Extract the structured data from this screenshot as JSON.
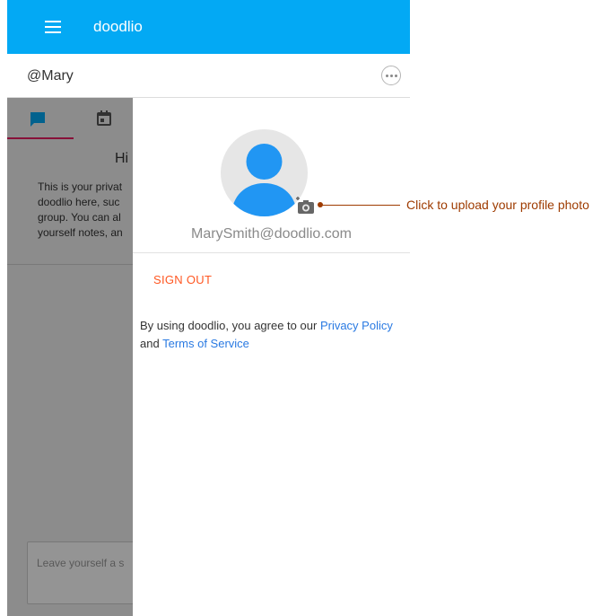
{
  "header": {
    "app_title": "doodlio",
    "menu_icon": "hamburger-menu-icon",
    "bg_color": "#03a9f4"
  },
  "user_bar": {
    "username": "@Mary",
    "more_icon": "more-options-icon"
  },
  "chat_pane": {
    "tabs": [
      {
        "icon": "chat-bubble-icon",
        "active": true
      },
      {
        "icon": "calendar-icon",
        "active": false
      }
    ],
    "greeting": "Hi",
    "intro_lines": [
      "This is your privat",
      "doodlio here, suc",
      "group. You can al",
      "yourself notes, an"
    ],
    "note_placeholder": "Leave yourself a s"
  },
  "profile_panel": {
    "email": "MarySmith@doodlio.com",
    "camera_icon": "add-photo-camera-icon",
    "sign_out_label": "SIGN OUT",
    "agreement": {
      "prefix": "By using doodlio, you agree to our",
      "privacy_link": "Privacy Policy",
      "and": "and",
      "terms_link": "Terms of Service"
    }
  },
  "callout": {
    "text": "Click to upload your profile photo",
    "color": "#9e3b00"
  },
  "colors": {
    "accent": "#03a9f4",
    "active_tab": "#e91e63",
    "sign_out": "#ff5722",
    "link": "#2a7ae2"
  }
}
